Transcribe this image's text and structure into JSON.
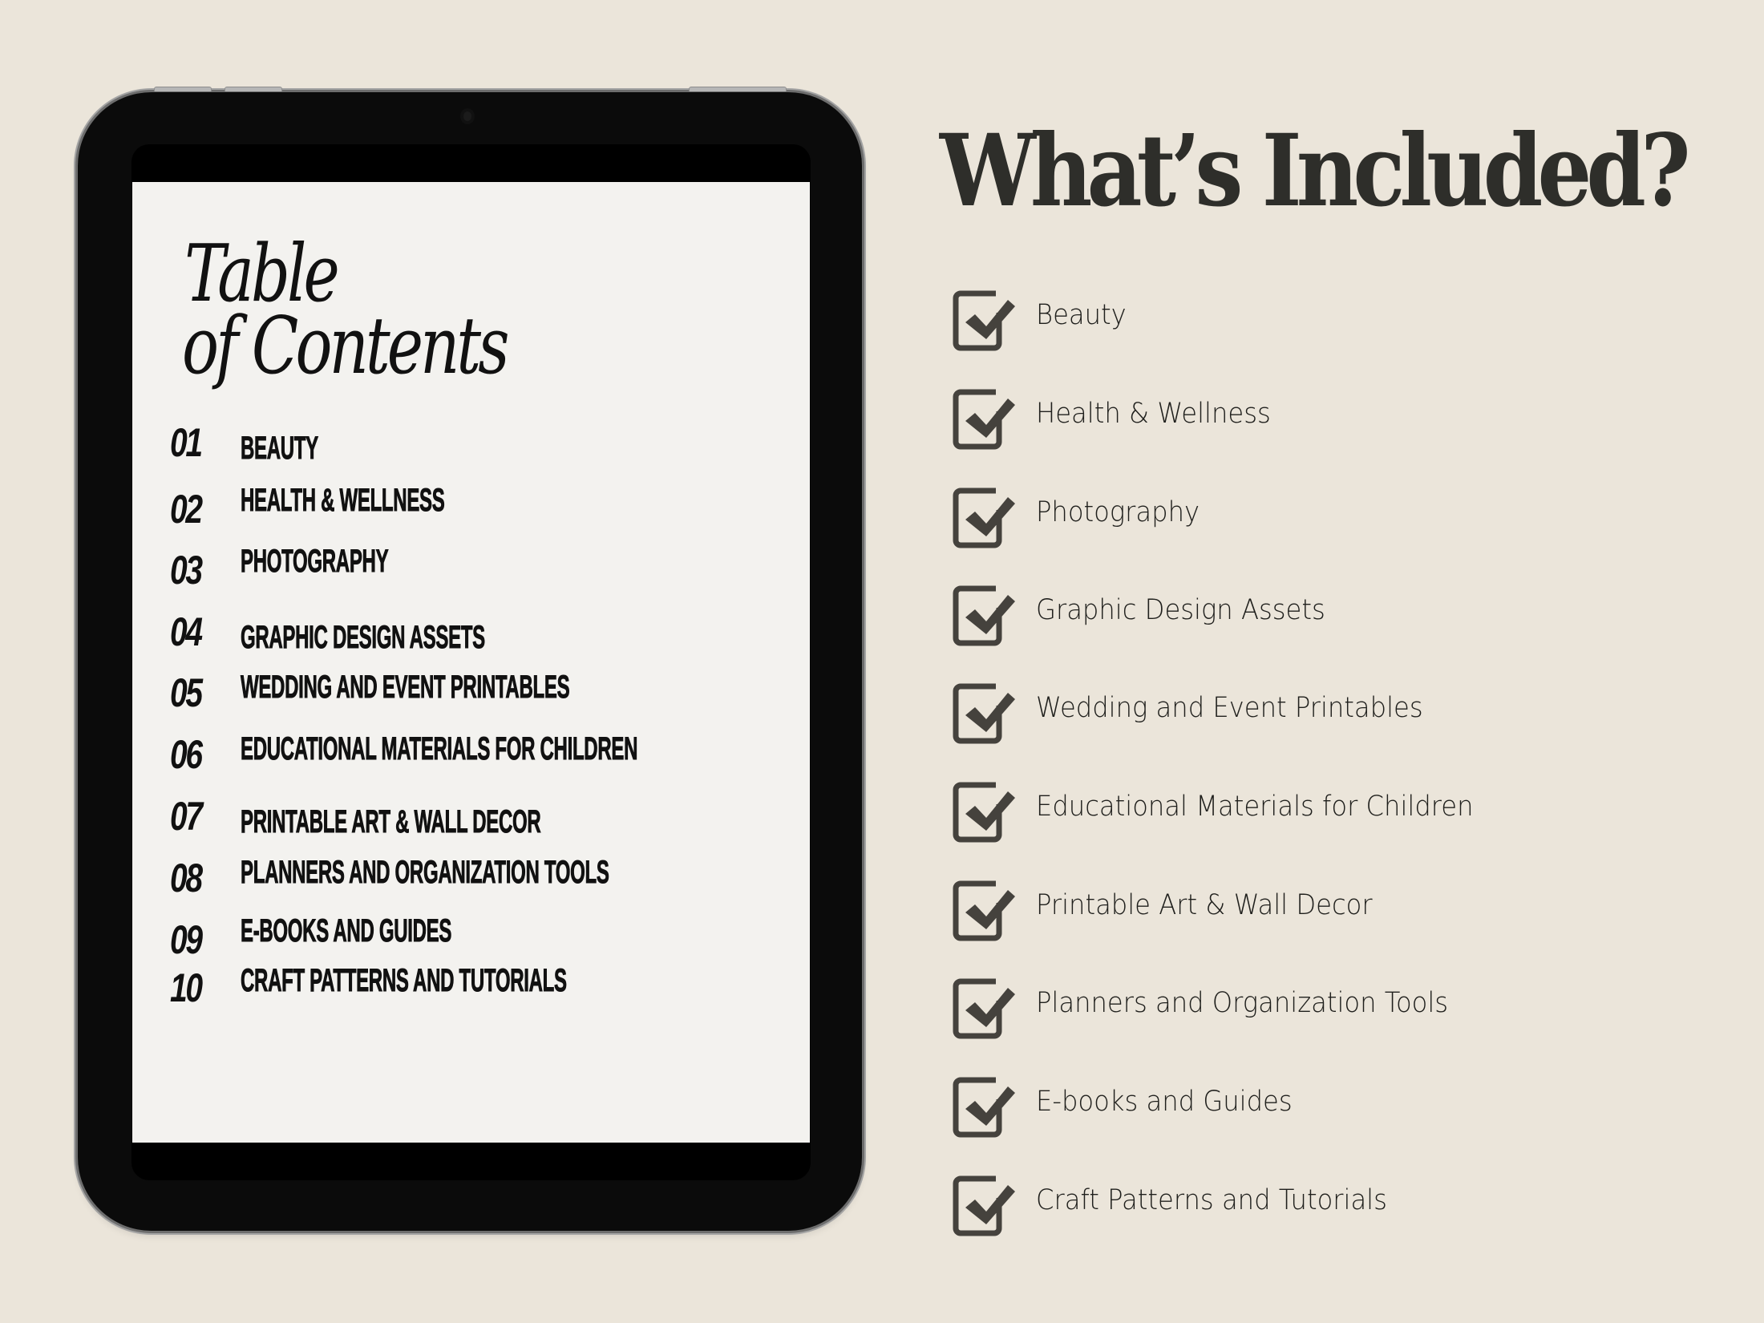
{
  "colors": {
    "background": "#ebe5da",
    "headline": "#2e2e2a",
    "checkbox": "#45423d",
    "screen": "#f3f2ef",
    "tablet_frame": "#0b0b0b"
  },
  "tablet": {
    "screen": {
      "title_line1": "Table",
      "title_line2": "of Contents",
      "toc": [
        {
          "num": "01",
          "label": "BEAUTY"
        },
        {
          "num": "02",
          "label": "HEALTH & WELLNESS"
        },
        {
          "num": "03",
          "label": "PHOTOGRAPHY"
        },
        {
          "num": "04",
          "label": "GRAPHIC DESIGN ASSETS"
        },
        {
          "num": "05",
          "label": "WEDDING AND EVENT PRINTABLES"
        },
        {
          "num": "06",
          "label": "EDUCATIONAL MATERIALS FOR CHILDREN"
        },
        {
          "num": "07",
          "label": "PRINTABLE ART & WALL DECOR"
        },
        {
          "num": "08",
          "label": "PLANNERS AND ORGANIZATION TOOLS"
        },
        {
          "num": "09",
          "label": "E-BOOKS AND GUIDES"
        },
        {
          "num": "10",
          "label": "CRAFT PATTERNS AND TUTORIALS"
        }
      ]
    }
  },
  "included": {
    "headline": "What’s Included?",
    "icon": "checked-checkbox-icon",
    "items": [
      {
        "label": "Beauty",
        "checked": true
      },
      {
        "label": "Health & Wellness",
        "checked": true
      },
      {
        "label": "Photography",
        "checked": true
      },
      {
        "label": "Graphic Design Assets",
        "checked": true
      },
      {
        "label": "Wedding and Event Printables",
        "checked": true
      },
      {
        "label": "Educational Materials for Children",
        "checked": true
      },
      {
        "label": "Printable Art & Wall Decor",
        "checked": true
      },
      {
        "label": "Planners and Organization Tools",
        "checked": true
      },
      {
        "label": "E-books and Guides",
        "checked": true
      },
      {
        "label": "Craft Patterns and Tutorials",
        "checked": true
      }
    ]
  }
}
